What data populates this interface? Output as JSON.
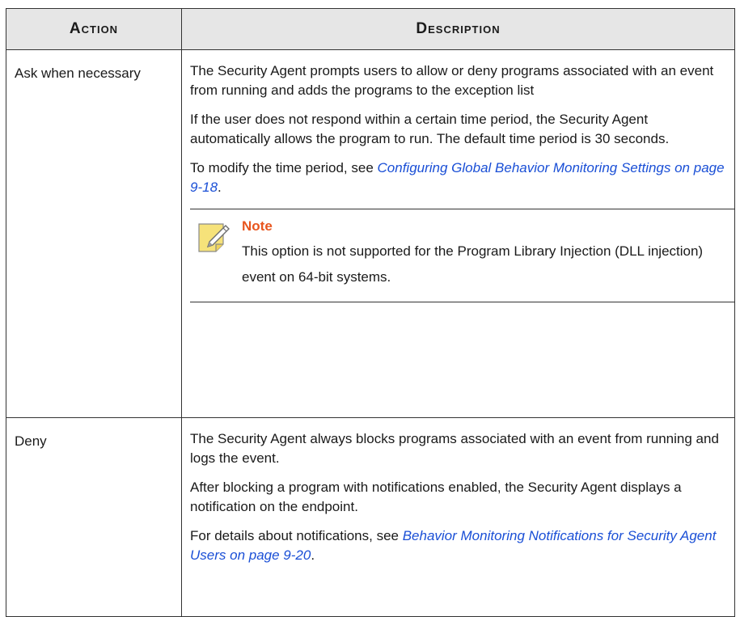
{
  "table": {
    "headers": {
      "action": "Action",
      "description": "Description"
    },
    "rows": [
      {
        "action": "Ask when necessary",
        "paragraphs": [
          {
            "text": "The Security Agent prompts users to allow or deny programs associated with an event from running and adds the programs to the exception list"
          },
          {
            "text": "If the user does not respond within a certain time period, the Security Agent automatically allows the program to run. The default time period is 30 seconds."
          },
          {
            "prefix": "To modify the time period, see ",
            "link": "Configuring Global Behavior Monitoring Settings on page 9-18",
            "suffix": "."
          }
        ],
        "note": {
          "title": "Note",
          "text": "This option is not supported for the Program Library Injection (DLL injection) event on 64-bit systems.",
          "icon": "note-pencil-icon"
        }
      },
      {
        "action": "Deny",
        "paragraphs": [
          {
            "text": "The Security Agent always blocks programs associated with an event from running and logs the event."
          },
          {
            "text": "After blocking a program with notifications enabled, the Security Agent displays a notification on the endpoint."
          },
          {
            "prefix": "For details about notifications, see ",
            "link": "Behavior Monitoring Notifications for Security Agent Users on page 9-20",
            "suffix": "."
          }
        ]
      }
    ]
  },
  "colors": {
    "header_bg": "#e6e6e6",
    "link": "#1a4fd6",
    "note_title": "#e8551e",
    "note_icon_fill": "#f6e27a",
    "border": "#333333"
  }
}
